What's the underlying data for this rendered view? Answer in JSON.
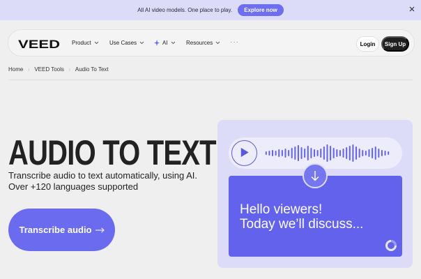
{
  "banner": {
    "text": "All AI video models. One place to play.",
    "button_label": "Explore now"
  },
  "nav": {
    "logo": "VEED",
    "items": [
      {
        "label": "Product"
      },
      {
        "label": "Use Cases"
      },
      {
        "label": "AI"
      },
      {
        "label": "Resources"
      }
    ],
    "more": "···",
    "login_label": "Login",
    "signup_label": "Sign Up"
  },
  "breadcrumbs": [
    "Home",
    "VEED Tools",
    "Audio To Text"
  ],
  "hero": {
    "title": "AUDIO TO TEXT",
    "subtitle": "Transcribe audio to text automatically, using AI. Over +120 languages supported",
    "cta_label": "Transcribe audio"
  },
  "illustration": {
    "transcript_line1": "Hello viewers!",
    "transcript_line2": "Today we’ll discuss..."
  },
  "colors": {
    "accent": "#6b6bef",
    "banner_bg": "#dcdcf9",
    "card_bg": "#6262ec",
    "dark": "#1f1f1f"
  },
  "icons": [
    "close-icon",
    "chevron-down-icon",
    "ai-spark-icon",
    "arrow-right-icon",
    "play-icon",
    "waveform-icon",
    "arrow-down-icon",
    "loading-icon"
  ]
}
